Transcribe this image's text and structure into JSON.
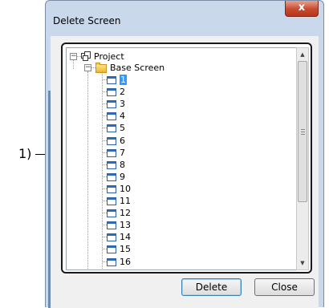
{
  "callout": {
    "label": "1)"
  },
  "window": {
    "title": "Delete Screen",
    "close_glyph": "x"
  },
  "tree": {
    "root": {
      "label": "Project",
      "icon": "project-icon"
    },
    "folder": {
      "label": "Base Screen",
      "icon": "folder-icon"
    },
    "screens": [
      "1",
      "2",
      "3",
      "4",
      "5",
      "6",
      "7",
      "8",
      "9",
      "10",
      "11",
      "12",
      "13",
      "14",
      "15",
      "16"
    ],
    "selected": "1",
    "scroll_down_glyph": "▼",
    "scroll_up_glyph": "▲"
  },
  "buttons": {
    "delete_label": "Delete",
    "close_label": "Close"
  },
  "colors": {
    "selection": "#3399ff",
    "close_button": "#c74a2e",
    "frame": "#c9d8ea"
  }
}
